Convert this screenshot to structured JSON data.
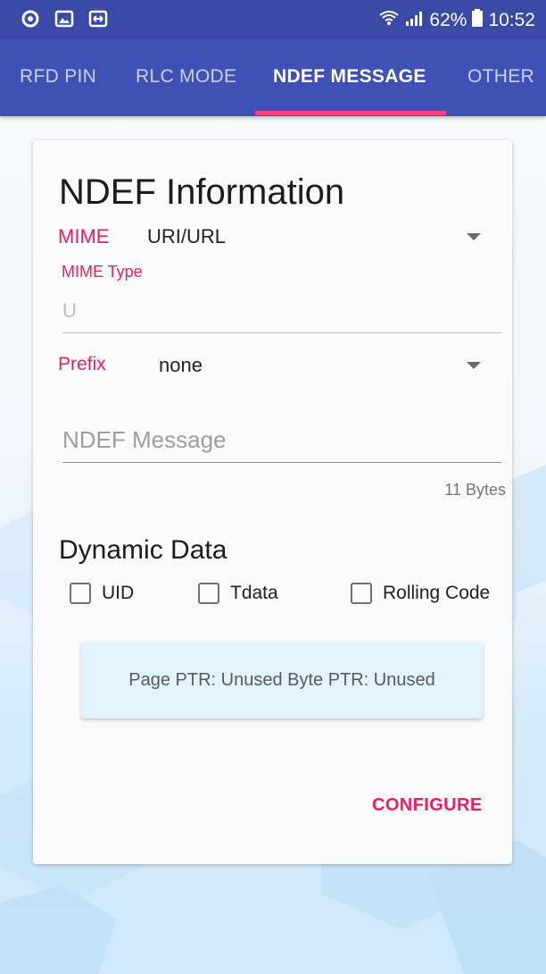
{
  "status_bar": {
    "battery": "62%",
    "time": "10:52",
    "icons": [
      "sync-icon",
      "gallery-icon",
      "cast-icon",
      "wifi-icon",
      "signal-icon",
      "battery-icon"
    ]
  },
  "tabs": [
    {
      "label": "RFD PIN",
      "active": false
    },
    {
      "label": "RLC MODE",
      "active": false
    },
    {
      "label": "NDEF MESSAGE",
      "active": true
    },
    {
      "label": "OTHER",
      "active": false
    }
  ],
  "colors": {
    "primary": "#3f51b5",
    "status": "#3a4aa6",
    "accent": "#ff4081",
    "pink_text": "#e91e63",
    "info_box": "#e1f3fc"
  },
  "ndef": {
    "title": "NDEF Information",
    "mime_label": "MIME",
    "mime_value": "URI/URL",
    "mime_type_label": "MIME Type",
    "mime_type_value": "U",
    "prefix_label": "Prefix",
    "prefix_value": "none",
    "message_placeholder": "NDEF Message",
    "message_value": "",
    "bytes": "11 Bytes"
  },
  "dynamic": {
    "title": "Dynamic Data",
    "uid_label": "UID",
    "tdata_label": "Tdata",
    "rolling_label": "Rolling Code"
  },
  "pointer_info": "Page PTR: Unused Byte PTR: Unused",
  "configure_label": "CONFIGURE"
}
